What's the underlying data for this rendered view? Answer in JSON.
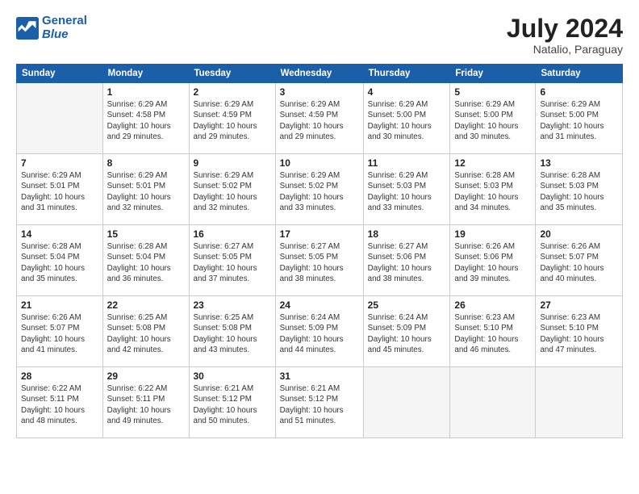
{
  "header": {
    "logo_line1": "General",
    "logo_line2": "Blue",
    "title": "July 2024",
    "subtitle": "Natalio, Paraguay"
  },
  "columns": [
    "Sunday",
    "Monday",
    "Tuesday",
    "Wednesday",
    "Thursday",
    "Friday",
    "Saturday"
  ],
  "weeks": [
    [
      {
        "day": "",
        "info": ""
      },
      {
        "day": "1",
        "info": "Sunrise: 6:29 AM\nSunset: 4:58 PM\nDaylight: 10 hours\nand 29 minutes."
      },
      {
        "day": "2",
        "info": "Sunrise: 6:29 AM\nSunset: 4:59 PM\nDaylight: 10 hours\nand 29 minutes."
      },
      {
        "day": "3",
        "info": "Sunrise: 6:29 AM\nSunset: 4:59 PM\nDaylight: 10 hours\nand 29 minutes."
      },
      {
        "day": "4",
        "info": "Sunrise: 6:29 AM\nSunset: 5:00 PM\nDaylight: 10 hours\nand 30 minutes."
      },
      {
        "day": "5",
        "info": "Sunrise: 6:29 AM\nSunset: 5:00 PM\nDaylight: 10 hours\nand 30 minutes."
      },
      {
        "day": "6",
        "info": "Sunrise: 6:29 AM\nSunset: 5:00 PM\nDaylight: 10 hours\nand 31 minutes."
      }
    ],
    [
      {
        "day": "7",
        "info": "Sunrise: 6:29 AM\nSunset: 5:01 PM\nDaylight: 10 hours\nand 31 minutes."
      },
      {
        "day": "8",
        "info": "Sunrise: 6:29 AM\nSunset: 5:01 PM\nDaylight: 10 hours\nand 32 minutes."
      },
      {
        "day": "9",
        "info": "Sunrise: 6:29 AM\nSunset: 5:02 PM\nDaylight: 10 hours\nand 32 minutes."
      },
      {
        "day": "10",
        "info": "Sunrise: 6:29 AM\nSunset: 5:02 PM\nDaylight: 10 hours\nand 33 minutes."
      },
      {
        "day": "11",
        "info": "Sunrise: 6:29 AM\nSunset: 5:03 PM\nDaylight: 10 hours\nand 33 minutes."
      },
      {
        "day": "12",
        "info": "Sunrise: 6:28 AM\nSunset: 5:03 PM\nDaylight: 10 hours\nand 34 minutes."
      },
      {
        "day": "13",
        "info": "Sunrise: 6:28 AM\nSunset: 5:03 PM\nDaylight: 10 hours\nand 35 minutes."
      }
    ],
    [
      {
        "day": "14",
        "info": "Sunrise: 6:28 AM\nSunset: 5:04 PM\nDaylight: 10 hours\nand 35 minutes."
      },
      {
        "day": "15",
        "info": "Sunrise: 6:28 AM\nSunset: 5:04 PM\nDaylight: 10 hours\nand 36 minutes."
      },
      {
        "day": "16",
        "info": "Sunrise: 6:27 AM\nSunset: 5:05 PM\nDaylight: 10 hours\nand 37 minutes."
      },
      {
        "day": "17",
        "info": "Sunrise: 6:27 AM\nSunset: 5:05 PM\nDaylight: 10 hours\nand 38 minutes."
      },
      {
        "day": "18",
        "info": "Sunrise: 6:27 AM\nSunset: 5:06 PM\nDaylight: 10 hours\nand 38 minutes."
      },
      {
        "day": "19",
        "info": "Sunrise: 6:26 AM\nSunset: 5:06 PM\nDaylight: 10 hours\nand 39 minutes."
      },
      {
        "day": "20",
        "info": "Sunrise: 6:26 AM\nSunset: 5:07 PM\nDaylight: 10 hours\nand 40 minutes."
      }
    ],
    [
      {
        "day": "21",
        "info": "Sunrise: 6:26 AM\nSunset: 5:07 PM\nDaylight: 10 hours\nand 41 minutes."
      },
      {
        "day": "22",
        "info": "Sunrise: 6:25 AM\nSunset: 5:08 PM\nDaylight: 10 hours\nand 42 minutes."
      },
      {
        "day": "23",
        "info": "Sunrise: 6:25 AM\nSunset: 5:08 PM\nDaylight: 10 hours\nand 43 minutes."
      },
      {
        "day": "24",
        "info": "Sunrise: 6:24 AM\nSunset: 5:09 PM\nDaylight: 10 hours\nand 44 minutes."
      },
      {
        "day": "25",
        "info": "Sunrise: 6:24 AM\nSunset: 5:09 PM\nDaylight: 10 hours\nand 45 minutes."
      },
      {
        "day": "26",
        "info": "Sunrise: 6:23 AM\nSunset: 5:10 PM\nDaylight: 10 hours\nand 46 minutes."
      },
      {
        "day": "27",
        "info": "Sunrise: 6:23 AM\nSunset: 5:10 PM\nDaylight: 10 hours\nand 47 minutes."
      }
    ],
    [
      {
        "day": "28",
        "info": "Sunrise: 6:22 AM\nSunset: 5:11 PM\nDaylight: 10 hours\nand 48 minutes."
      },
      {
        "day": "29",
        "info": "Sunrise: 6:22 AM\nSunset: 5:11 PM\nDaylight: 10 hours\nand 49 minutes."
      },
      {
        "day": "30",
        "info": "Sunrise: 6:21 AM\nSunset: 5:12 PM\nDaylight: 10 hours\nand 50 minutes."
      },
      {
        "day": "31",
        "info": "Sunrise: 6:21 AM\nSunset: 5:12 PM\nDaylight: 10 hours\nand 51 minutes."
      },
      {
        "day": "",
        "info": ""
      },
      {
        "day": "",
        "info": ""
      },
      {
        "day": "",
        "info": ""
      }
    ]
  ]
}
